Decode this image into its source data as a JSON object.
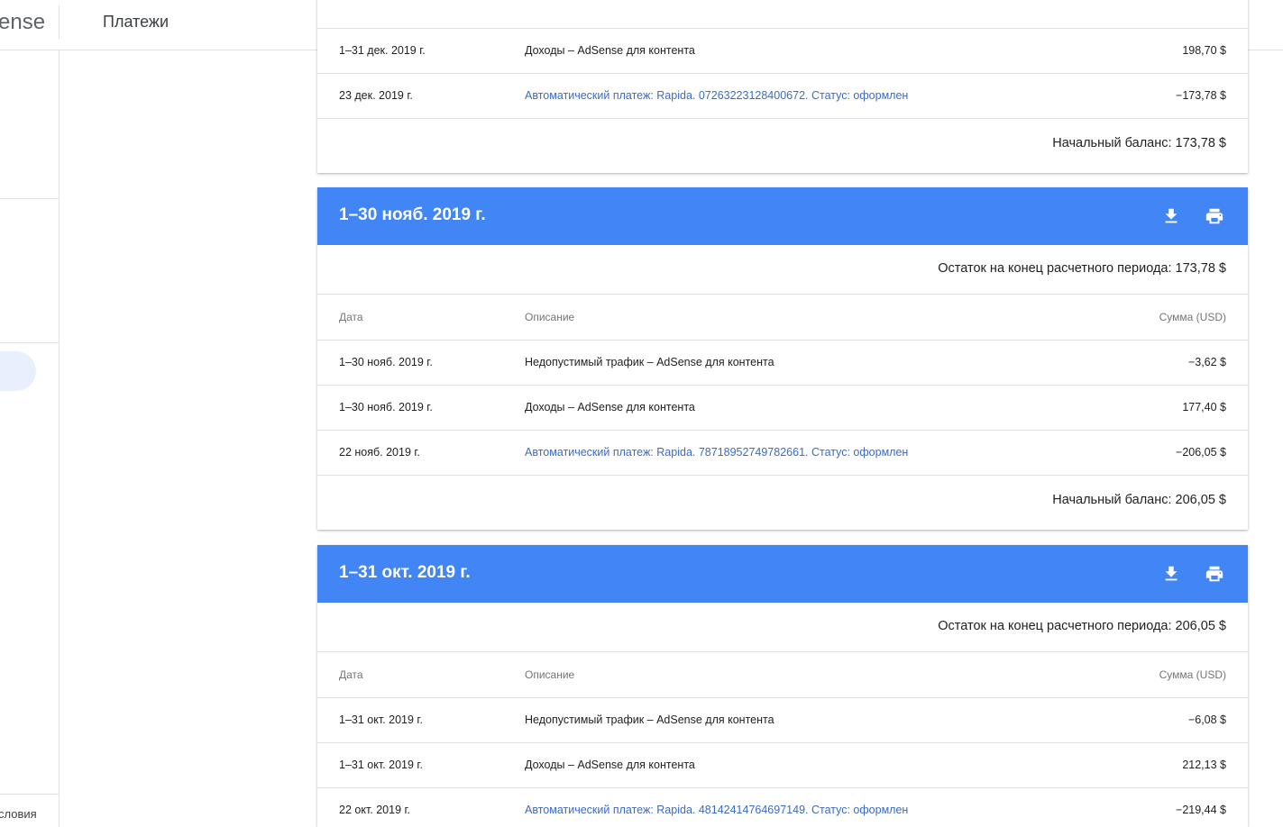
{
  "topbar": {
    "brand": "ense",
    "title": "Платежи"
  },
  "sidebar": {
    "footer_link": "словия"
  },
  "columns": {
    "date": "Дата",
    "description": "Описание",
    "amount": "Сумма (USD)"
  },
  "dec": {
    "partial_row": {
      "date": "1–31 дек. 2019 г.",
      "desc": "Доходы – AdSense для контента",
      "amount": "198,70 $"
    },
    "payment_row": {
      "date": "23 дек. 2019 г.",
      "desc": "Автоматический платеж: Rapida. 07263223128400672. Статус: оформлен",
      "amount": "−173,78 $"
    },
    "start_balance": "Начальный баланс: 173,78 $"
  },
  "nov": {
    "period": "1–30 нояб. 2019 г.",
    "end_balance": "Остаток на конец расчетного периода: 173,78 $",
    "rows": [
      {
        "date": "1–30 нояб. 2019 г.",
        "desc": "Недопустимый трафик – AdSense для контента",
        "amount": "−3,62 $"
      },
      {
        "date": "1–30 нояб. 2019 г.",
        "desc": "Доходы – AdSense для контента",
        "amount": "177,40 $"
      },
      {
        "date": "22 нояб. 2019 г.",
        "desc": "Автоматический платеж: Rapida. 78718952749782661. Статус: оформлен",
        "amount": "−206,05 $"
      }
    ],
    "start_balance": "Начальный баланс: 206,05 $"
  },
  "oct": {
    "period": "1–31 окт. 2019 г.",
    "end_balance": "Остаток на конец расчетного периода: 206,05 $",
    "rows": [
      {
        "date": "1–31 окт. 2019 г.",
        "desc": "Недопустимый трафик – AdSense для контента",
        "amount": "−6,08 $"
      },
      {
        "date": "1–31 окт. 2019 г.",
        "desc": "Доходы – AdSense для контента",
        "amount": "212,13 $"
      },
      {
        "date": "22 окт. 2019 г.",
        "desc": "Автоматический платеж: Rapida. 48142414764697149. Статус: оформлен",
        "amount": "−219,44 $"
      }
    ]
  },
  "icons": {
    "download": "download-icon",
    "print": "print-icon"
  },
  "colors": {
    "header_blue": "#4285f4",
    "link_blue": "#3b6bc4",
    "active_nav": "#e8f0fe"
  }
}
